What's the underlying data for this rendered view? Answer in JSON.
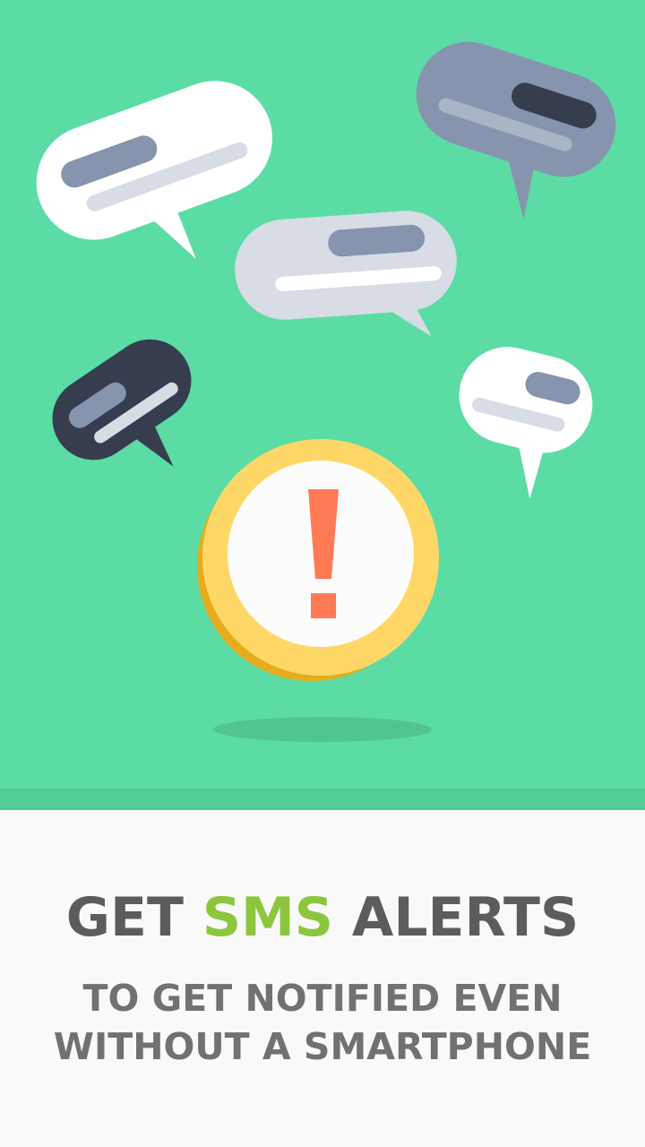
{
  "headline": {
    "part1": "GET ",
    "highlight": "SMS",
    "part2": " ALERTS"
  },
  "subheadline": {
    "line1": "TO GET NOTIFIED EVEN",
    "line2": "WITHOUT A SMARTPHONE"
  },
  "alert_symbol": "!",
  "colors": {
    "background_top": "#5cdca5",
    "background_bottom": "#f9f9fa",
    "accent": "#8cc63f",
    "headline_text": "#5b5c5e",
    "alert_ring": "#ffd766",
    "alert_mark": "#ff7a55"
  }
}
